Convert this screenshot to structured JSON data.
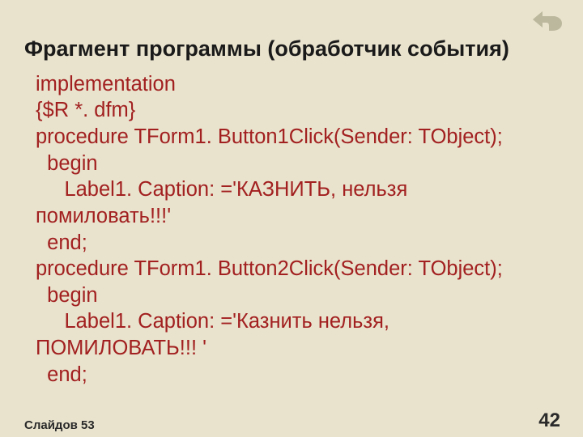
{
  "title": "Фрагмент программы (обработчик события)",
  "code": "implementation\n{$R *. dfm}\nprocedure TForm1. Button1Click(Sender: TObject);\n  begin\n     Label1. Caption: ='КАЗНИТЬ, нельзя\nпомиловать!!!'\n  end;\nprocedure TForm1. Button2Click(Sender: TObject);\n  begin\n     Label1. Caption: ='Казнить нельзя,\nПОМИЛОВАТЬ!!! '\n  end;",
  "footer": {
    "slides_label": "Слайдов 53",
    "page_number": "42"
  }
}
